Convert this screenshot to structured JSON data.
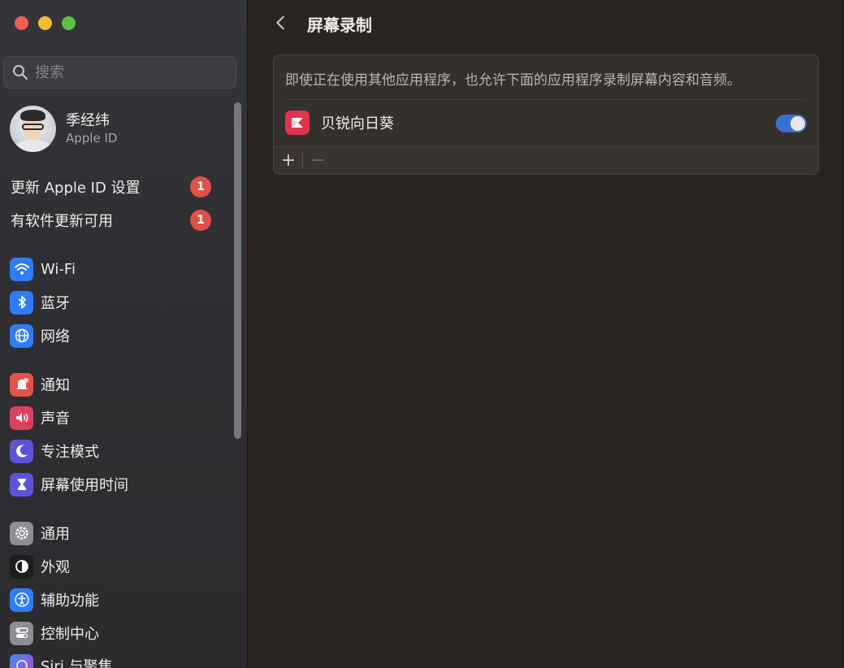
{
  "sidebar": {
    "search": {
      "placeholder": "搜索"
    },
    "account": {
      "name": "季经纬",
      "subtitle": "Apple ID"
    },
    "alerts": [
      {
        "label": "更新 Apple ID 设置",
        "badge": "1"
      },
      {
        "label": "有软件更新可用",
        "badge": "1"
      }
    ],
    "items": [
      {
        "label": "Wi-Fi",
        "icon": "wifi-icon",
        "color": "#2f7cf6"
      },
      {
        "label": "蓝牙",
        "icon": "bluetooth-icon",
        "color": "#2f7cf6"
      },
      {
        "label": "网络",
        "icon": "globe-icon",
        "color": "#2f7cf6"
      },
      {
        "label": "通知",
        "icon": "bell-icon",
        "color": "#e4534a"
      },
      {
        "label": "声音",
        "icon": "speaker-icon",
        "color": "#e0405e"
      },
      {
        "label": "专注模式",
        "icon": "moon-icon",
        "color": "#5b55d6"
      },
      {
        "label": "屏幕使用时间",
        "icon": "hourglass-icon",
        "color": "#5b55d6"
      },
      {
        "label": "通用",
        "icon": "gear-icon",
        "color": "#8e8e93"
      },
      {
        "label": "外观",
        "icon": "appearance-icon",
        "color": "#1c1c1e"
      },
      {
        "label": "辅助功能",
        "icon": "accessibility-icon",
        "color": "#2f7cf6"
      },
      {
        "label": "控制中心",
        "icon": "control-center-icon",
        "color": "#8e8e93"
      },
      {
        "label": "Siri 与聚焦",
        "icon": "siri-icon",
        "color": "#6a4fd8"
      }
    ]
  },
  "main": {
    "title": "屏幕录制",
    "description": "即使正在使用其他应用程序，也允许下面的应用程序录制屏幕内容和音频。",
    "apps": [
      {
        "name": "贝锐向日葵",
        "icon": "sunlogin-app-icon",
        "enabled": true
      }
    ],
    "footer": {
      "add": "+",
      "remove": "−"
    }
  },
  "colors": {
    "accent": "#3b6fcf",
    "badge": "#e2504a",
    "close": "#ee5d56",
    "minimize": "#f3bc2f",
    "maximize": "#5fc13f"
  }
}
